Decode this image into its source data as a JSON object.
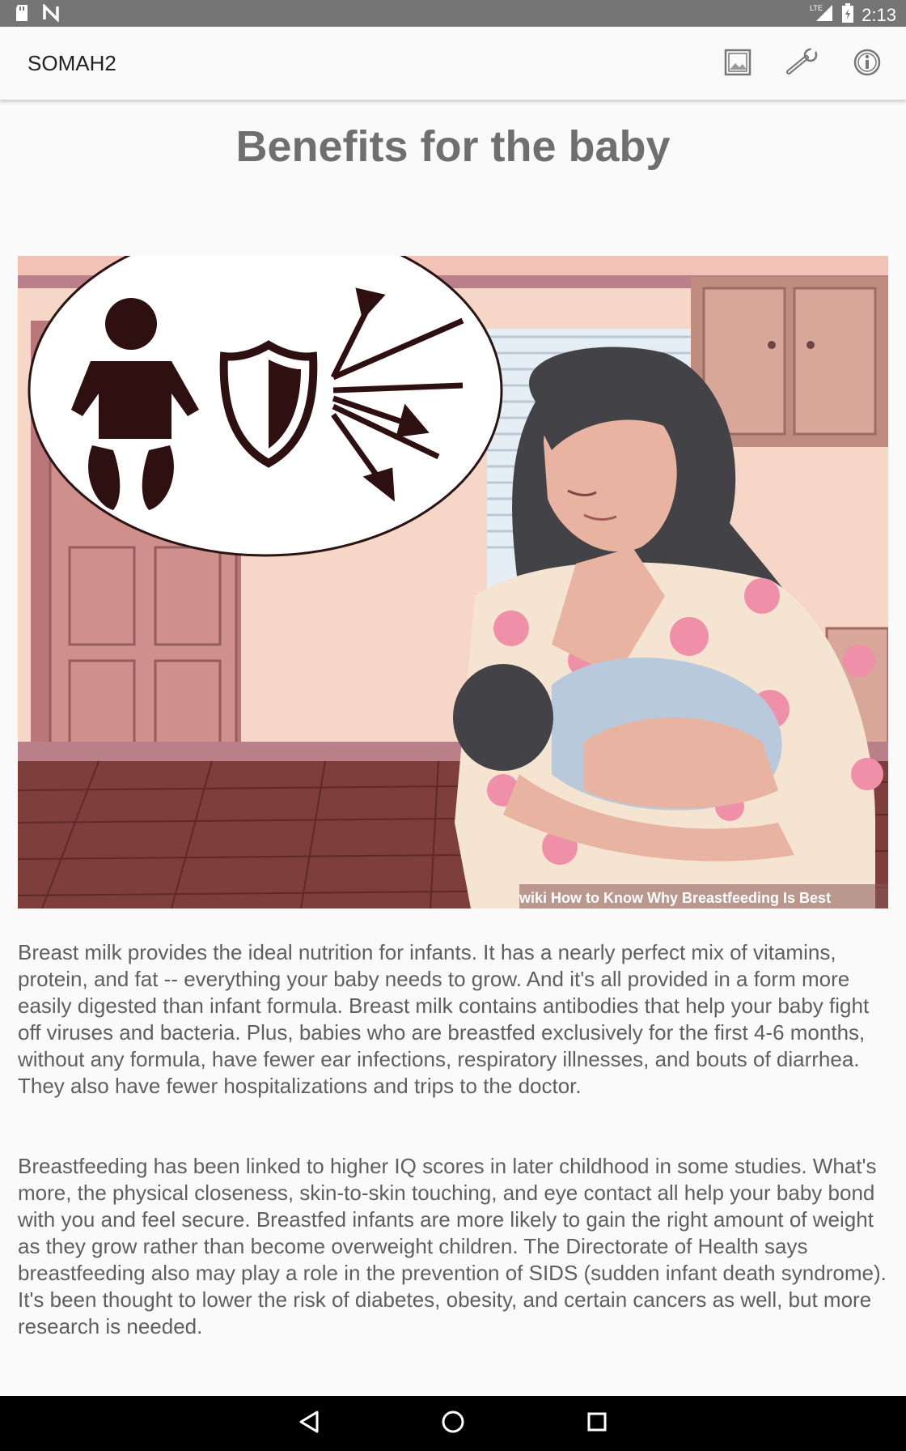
{
  "status_bar": {
    "time": "2:13",
    "network_label": "LTE",
    "icons": [
      "sd-card-icon",
      "n-logo-icon",
      "lte-signal-icon",
      "battery-icon"
    ]
  },
  "app_bar": {
    "title": "SOMAH2",
    "actions": [
      "image-icon",
      "wrench-icon",
      "info-icon"
    ]
  },
  "content": {
    "title": "Benefits for the baby",
    "image": {
      "caption_wiki": "wiki",
      "caption_text": "How to Know Why Breastfeeding Is Best"
    },
    "paragraphs": [
      "Breast milk provides the ideal nutrition for infants. It has a nearly perfect mix of vitamins, protein, and fat -- everything your baby needs to grow. And it's all provided in a form more easily digested than infant formula. Breast milk contains antibodies that help your baby fight off viruses and bacteria. Plus, babies who are breastfed exclusively for the first 4-6 months, without any formula, have fewer ear infections, respiratory illnesses, and bouts of diarrhea. They also have fewer hospitalizations and trips to the doctor.",
      "Breastfeeding has been linked to higher IQ scores in later childhood in some studies. What's more, the physical closeness, skin-to-skin touching, and eye contact all help your baby bond with you and feel secure. Breastfed infants are more likely to gain the right amount of weight as they grow rather than become overweight children. The Directorate of Health says breastfeeding also may play a role in the prevention of SIDS (sudden infant death syndrome). It's been thought to lower the risk of diabetes, obesity, and certain cancers as well, but more research is needed."
    ]
  },
  "nav_bar": {
    "buttons": [
      "back-icon",
      "home-icon",
      "recents-icon"
    ]
  },
  "colors": {
    "status_bar": "#757575",
    "title_text": "#6f6f6f",
    "body_text": "#5f5f5f",
    "nav_bar": "#000000"
  }
}
